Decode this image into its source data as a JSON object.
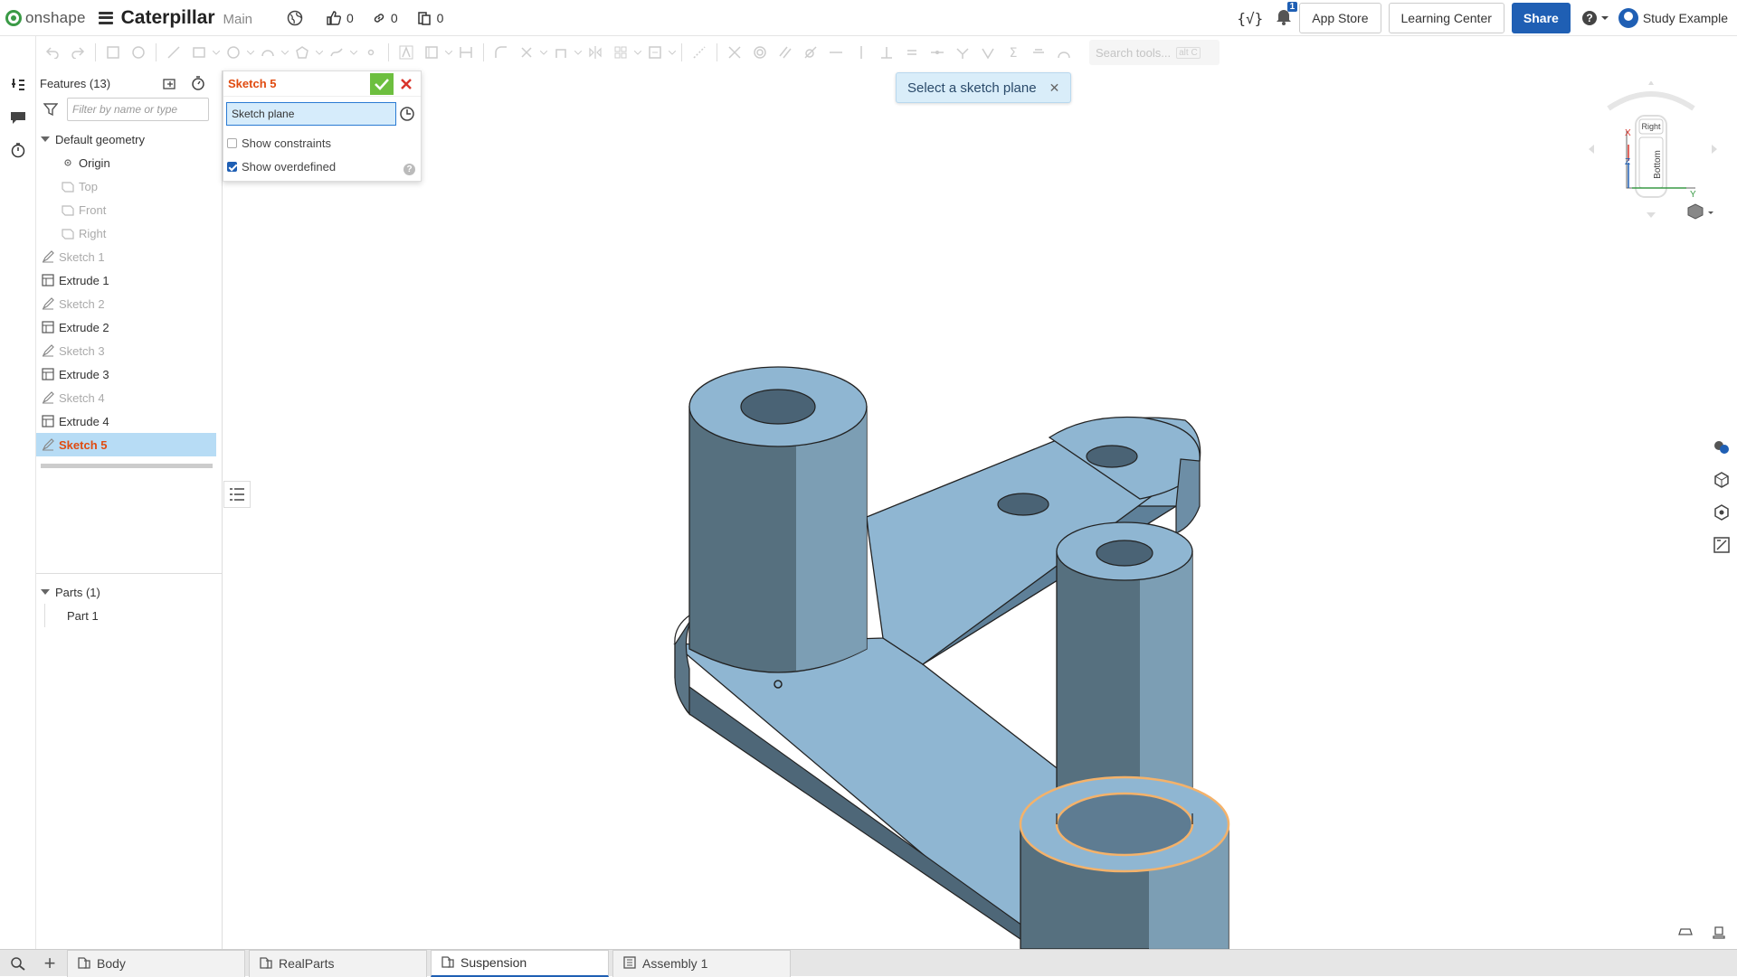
{
  "app": {
    "brand": "onshape",
    "document_title": "Caterpillar",
    "branch": "Main",
    "likes": "0",
    "links": "0",
    "copies": "0",
    "notifications": "1"
  },
  "header_buttons": {
    "app_store": "App Store",
    "learning_center": "Learning Center",
    "share": "Share",
    "user_name": "Study Example"
  },
  "search_tools": {
    "placeholder": "Search tools...",
    "shortcut": "alt C"
  },
  "feature_panel": {
    "title": "Features (13)",
    "filter_placeholder": "Filter by name or type",
    "group_default": "Default geometry",
    "items": [
      {
        "label": "Origin",
        "icon": "origin-icon",
        "dim": false,
        "indent": 2
      },
      {
        "label": "Top",
        "icon": "plane-icon",
        "dim": true,
        "indent": 2
      },
      {
        "label": "Front",
        "icon": "plane-icon",
        "dim": true,
        "indent": 2
      },
      {
        "label": "Right",
        "icon": "plane-icon",
        "dim": true,
        "indent": 2
      },
      {
        "label": "Sketch 1",
        "icon": "sketch-icon",
        "dim": true,
        "indent": 1
      },
      {
        "label": "Extrude 1",
        "icon": "extrude-icon",
        "dim": false,
        "indent": 1
      },
      {
        "label": "Sketch 2",
        "icon": "sketch-icon",
        "dim": true,
        "indent": 1
      },
      {
        "label": "Extrude 2",
        "icon": "extrude-icon",
        "dim": false,
        "indent": 1
      },
      {
        "label": "Sketch 3",
        "icon": "sketch-icon",
        "dim": true,
        "indent": 1
      },
      {
        "label": "Extrude 3",
        "icon": "extrude-icon",
        "dim": false,
        "indent": 1
      },
      {
        "label": "Sketch 4",
        "icon": "sketch-icon",
        "dim": true,
        "indent": 1
      },
      {
        "label": "Extrude 4",
        "icon": "extrude-icon",
        "dim": false,
        "indent": 1
      },
      {
        "label": "Sketch 5",
        "icon": "sketch-icon",
        "dim": false,
        "indent": 1,
        "selected": true
      }
    ],
    "parts_group": "Parts (1)",
    "parts": [
      "Part 1"
    ]
  },
  "sketch_dialog": {
    "title": "Sketch 5",
    "plane_field": "Sketch plane",
    "show_constraints": "Show constraints",
    "show_constraints_checked": false,
    "show_overdefined": "Show overdefined",
    "show_overdefined_checked": true
  },
  "toast": {
    "message": "Select a sketch plane"
  },
  "viewcube": {
    "face_top": "Right",
    "face_front": "Bottom",
    "axis_x": "X",
    "axis_y": "Y",
    "axis_z": "Z"
  },
  "tabs": [
    {
      "label": "Body",
      "icon": "part-studio-icon",
      "active": false
    },
    {
      "label": "RealParts",
      "icon": "part-studio-icon",
      "active": false
    },
    {
      "label": "Suspension",
      "icon": "part-studio-icon",
      "active": true
    },
    {
      "label": "Assembly 1",
      "icon": "assembly-icon",
      "active": false
    }
  ],
  "colors": {
    "accent": "#1f5fb4",
    "selected_feature": "#e04b10",
    "selected_row_bg": "#b7dcf5",
    "part_body": "#8fb6d2",
    "highlight_edge": "#f4b26a"
  }
}
